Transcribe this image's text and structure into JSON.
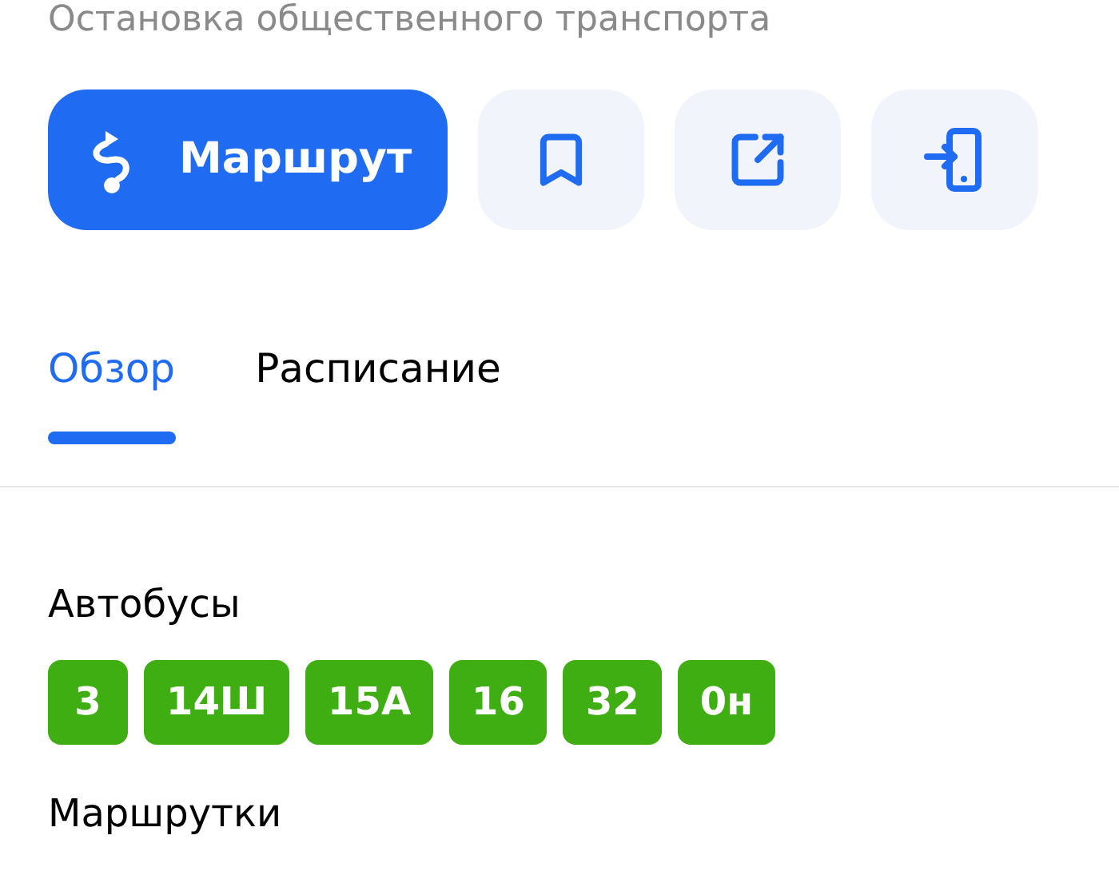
{
  "subtitle": "Остановка общественного транспорта",
  "actions": [
    {
      "kind": "route",
      "label": "Маршрут"
    },
    {
      "kind": "bookmark"
    },
    {
      "kind": "share"
    },
    {
      "kind": "send-to-phone"
    }
  ],
  "tabs": [
    {
      "label": "Обзор",
      "selected": true
    },
    {
      "label": "Расписание",
      "selected": false
    }
  ],
  "sections": [
    {
      "title": "Автобусы",
      "routes": [
        "3",
        "14Ш",
        "15А",
        "16",
        "32",
        "0н"
      ]
    },
    {
      "title": "Маршрутки"
    }
  ]
}
